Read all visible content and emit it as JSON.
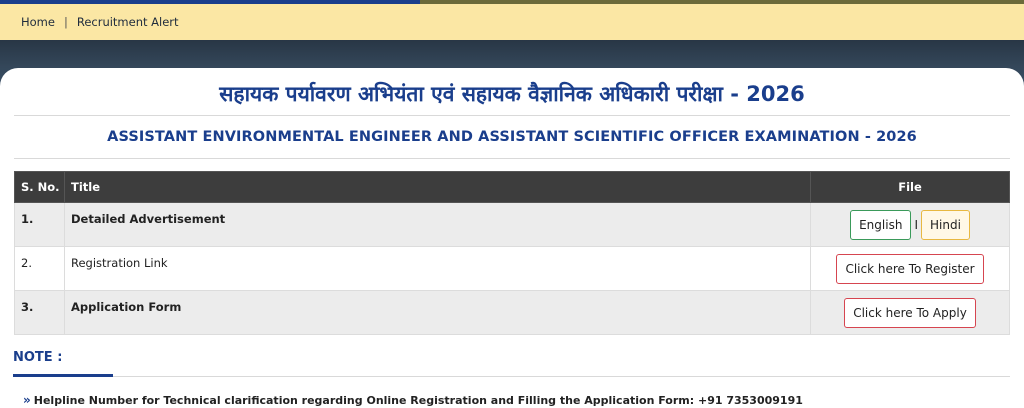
{
  "breadcrumb": {
    "home": "Home",
    "separator": "|",
    "current": "Recruitment Alert"
  },
  "heading": {
    "hindi": "सहायक पर्यावरण अभियंता एवं सहायक वैज्ञानिक अधिकारी परीक्षा - 2026",
    "english": "ASSISTANT ENVIRONMENTAL ENGINEER AND ASSISTANT SCIENTIFIC OFFICER EXAMINATION - 2026"
  },
  "table": {
    "headers": {
      "sno": "S. No.",
      "title": "Title",
      "file": "File"
    },
    "rows": [
      {
        "sno": "1.",
        "title": "Detailed Advertisement",
        "btn1": "English",
        "separator": "I",
        "btn2": "Hindi"
      },
      {
        "sno": "2.",
        "title": "Registration Link",
        "btn1": "Click here To Register"
      },
      {
        "sno": "3.",
        "title": "Application Form",
        "btn1": "Click here To Apply"
      }
    ]
  },
  "note": {
    "title": "NOTE :",
    "bullet_icon": "double-chevron-right-icon",
    "helpline": "Helpline Number for Technical clarification regarding Online Registration and Filling the Application Form: +91 7353009191"
  },
  "colors": {
    "accent": "#1a3e8c",
    "breadcrumb_bg": "#fbe7a4",
    "table_header": "#3d3d3d"
  }
}
